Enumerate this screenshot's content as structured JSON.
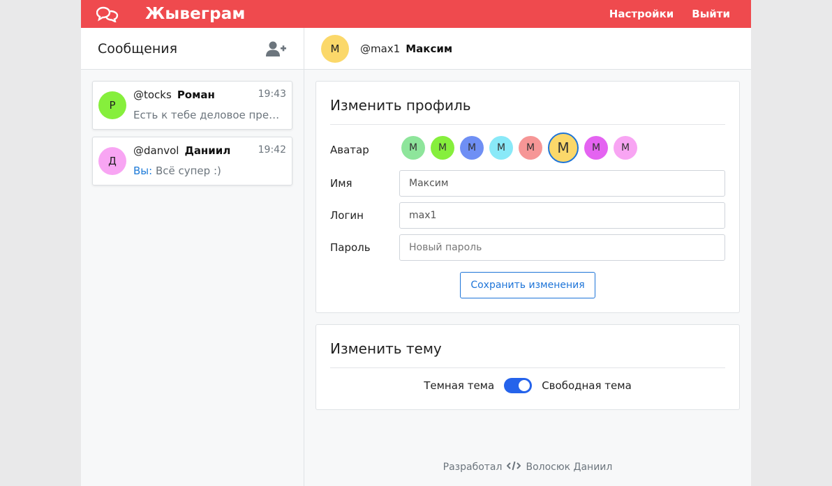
{
  "header": {
    "brand": "Жывеграм",
    "nav": [
      "Настройки",
      "Выйти"
    ],
    "accent": "#ef4a4e"
  },
  "sidebar": {
    "title": "Сообщения",
    "chats": [
      {
        "avatar": "Р",
        "avatar_color": "#86ef3c",
        "login": "@tocks",
        "name": "Роман",
        "time": "19:43",
        "you_prefix": "",
        "message": "Есть к тебе деловое предложение"
      },
      {
        "avatar": "Д",
        "avatar_color": "#f8a5f3",
        "login": "@danvol",
        "name": "Даниил",
        "time": "19:42",
        "you_prefix": "Вы:",
        "message": "Всё супер :)"
      }
    ]
  },
  "main": {
    "user": {
      "avatar": "М",
      "login": "@max1",
      "name": "Максим"
    },
    "profile": {
      "title": "Изменить профиль",
      "avatar_label": "Аватар",
      "avatar_letter": "М",
      "avatar_colors": [
        "#8ee59b",
        "#86ef3c",
        "#6f8ff4",
        "#89e9f8",
        "#f69696",
        "#fbd86a",
        "#e463f1",
        "#f8a5f3"
      ],
      "selected_color": "#fbd86a",
      "name_label": "Имя",
      "name_value": "Максим",
      "login_label": "Логин",
      "login_value": "max1",
      "password_label": "Пароль",
      "password_placeholder": "Новый пароль",
      "save_label": "Сохранить изменения"
    },
    "theme": {
      "title": "Изменить тему",
      "left_label": "Темная тема",
      "right_label": "Свободная тема",
      "toggle_on": true
    },
    "footer": {
      "prefix": "Разработал",
      "author": "Волосюк Даниил"
    }
  }
}
